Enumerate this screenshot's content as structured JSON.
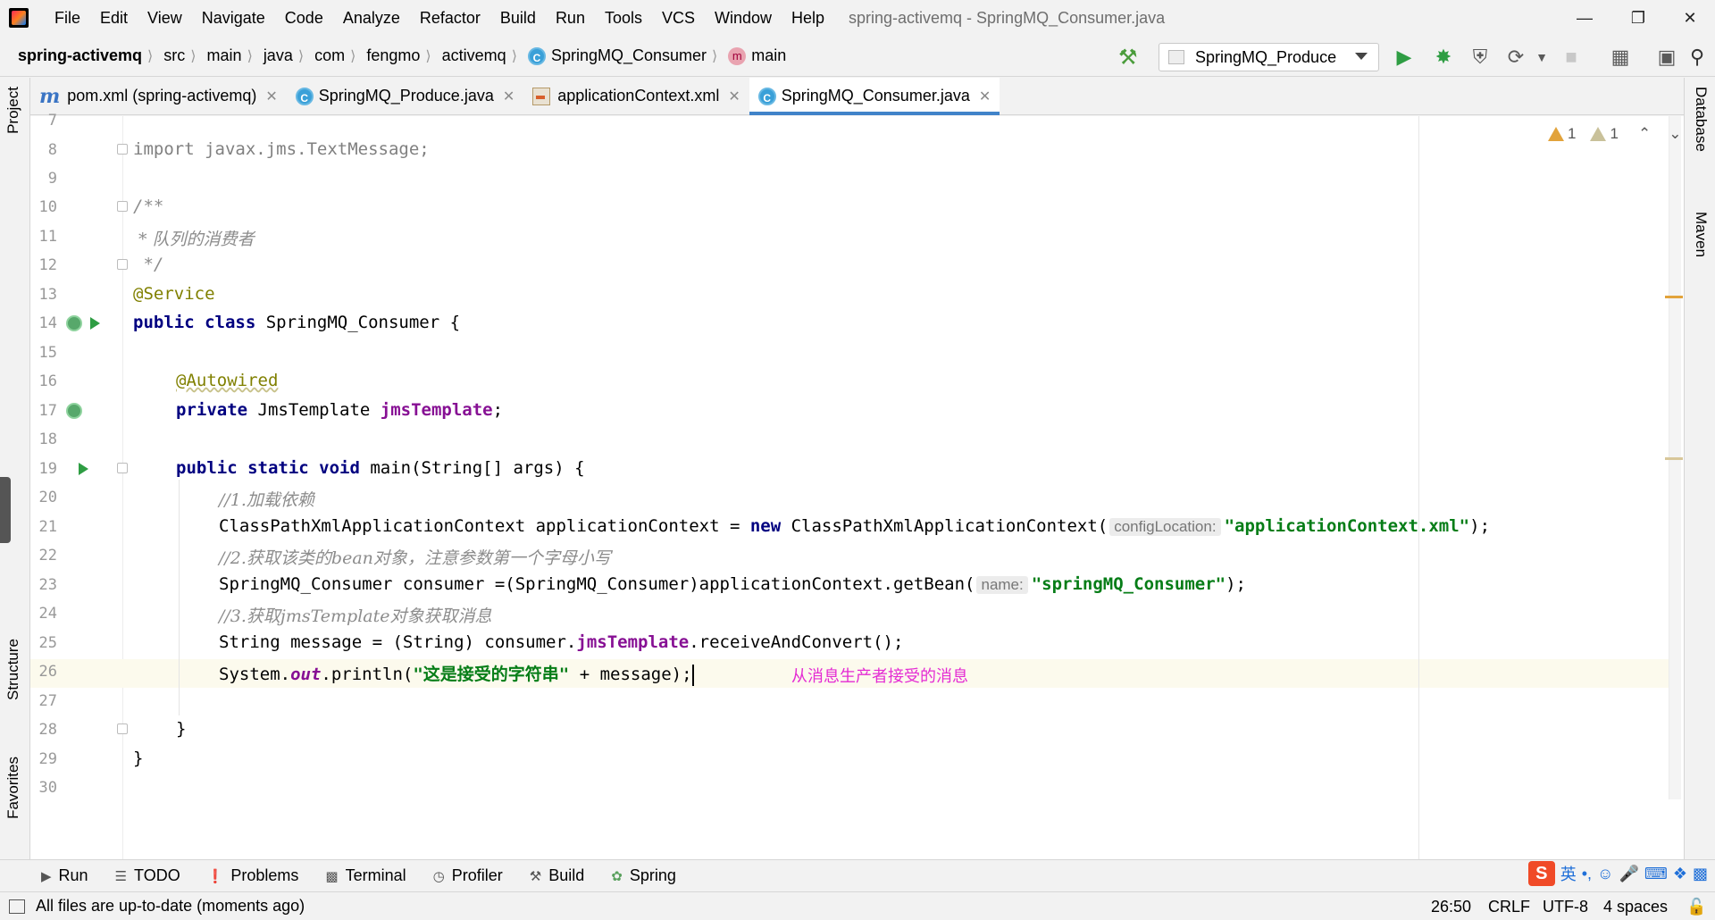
{
  "menu": {
    "items": [
      "File",
      "Edit",
      "View",
      "Navigate",
      "Code",
      "Analyze",
      "Refactor",
      "Build",
      "Run",
      "Tools",
      "VCS",
      "Window",
      "Help"
    ],
    "window_title": "spring-activemq - SpringMQ_Consumer.java"
  },
  "breadcrumbs": [
    "spring-activemq",
    "src",
    "main",
    "java",
    "com",
    "fengmo",
    "activemq",
    "SpringMQ_Consumer",
    "main"
  ],
  "run_config": {
    "name": "SpringMQ_Produce"
  },
  "tabs": [
    {
      "label": "pom.xml (spring-activemq)",
      "icon": "maven-icon"
    },
    {
      "label": "SpringMQ_Produce.java",
      "icon": "class-icon"
    },
    {
      "label": "applicationContext.xml",
      "icon": "xml-file-icon"
    },
    {
      "label": "SpringMQ_Consumer.java",
      "icon": "class-icon",
      "active": true
    }
  ],
  "side_tools": {
    "left": [
      "Project",
      "Structure",
      "Favorites"
    ],
    "right": [
      "Database",
      "Maven"
    ]
  },
  "inspections": {
    "warnings": "1",
    "weak_warnings": "1"
  },
  "editor": {
    "line_numbers": [
      "7",
      "8",
      "9",
      "10",
      "11",
      "12",
      "13",
      "14",
      "15",
      "16",
      "17",
      "18",
      "19",
      "20",
      "21",
      "22",
      "23",
      "24",
      "25",
      "26",
      "27",
      "28",
      "29",
      "30"
    ],
    "line8": {
      "kw": "import",
      "rest": " javax.jms.TextMessage;"
    },
    "line10": "/**",
    "line11": " * 队列的消费者",
    "line12": " */",
    "line13": "@Service",
    "line14": {
      "kw": "public class",
      "rest": " SpringMQ_Consumer {"
    },
    "line16": "@Autowired",
    "line17": {
      "kw": "private",
      "type": " JmsTemplate ",
      "field": "jmsTemplate",
      "end": ";"
    },
    "line19": {
      "kw": "public static void",
      "rest": " main(String[] args) {"
    },
    "line20": "//1.加载依赖",
    "line21": {
      "a": "ClassPathXmlApplicationContext applicationContext = ",
      "kw": "new",
      "b": " ClassPathXmlApplicationContext(",
      "hint": "configLocation:",
      "str": "\"applicationContext.xml\"",
      "end": ");"
    },
    "line22": "//2.获取该类的bean对象，注意参数第一个字母小写",
    "line23": {
      "a": "SpringMQ_Consumer consumer =(SpringMQ_Consumer)applicationContext.getBean(",
      "hint": "name:",
      "str": "\"springMQ_Consumer\"",
      "end": ");"
    },
    "line24": "//3.获取jmsTemplate对象获取消息",
    "line25": {
      "a": "String message = (String) consumer.",
      "field": "jmsTemplate",
      "b": ".receiveAndConvert();"
    },
    "line26": {
      "a": "System.",
      "sfield": "out",
      "b": ".println(",
      "str": "\"这是接受的字符串\"",
      "c": " + message);"
    },
    "line28": "}",
    "line29": "}",
    "annotation_note": "从消息生产者接受的消息"
  },
  "bottom_tools": [
    {
      "label": "Run",
      "icon": "run-icon"
    },
    {
      "label": "TODO",
      "icon": "todo-icon"
    },
    {
      "label": "Problems",
      "icon": "problems-icon"
    },
    {
      "label": "Terminal",
      "icon": "terminal-icon"
    },
    {
      "label": "Profiler",
      "icon": "profiler-icon"
    },
    {
      "label": "Build",
      "icon": "build-icon"
    },
    {
      "label": "Spring",
      "icon": "spring-icon"
    }
  ],
  "ime": {
    "lang": "英"
  },
  "status": {
    "message": "All files are up-to-date (moments ago)",
    "position": "26:50",
    "line_sep": "CRLF",
    "encoding": "UTF-8",
    "indent": "4 spaces"
  }
}
